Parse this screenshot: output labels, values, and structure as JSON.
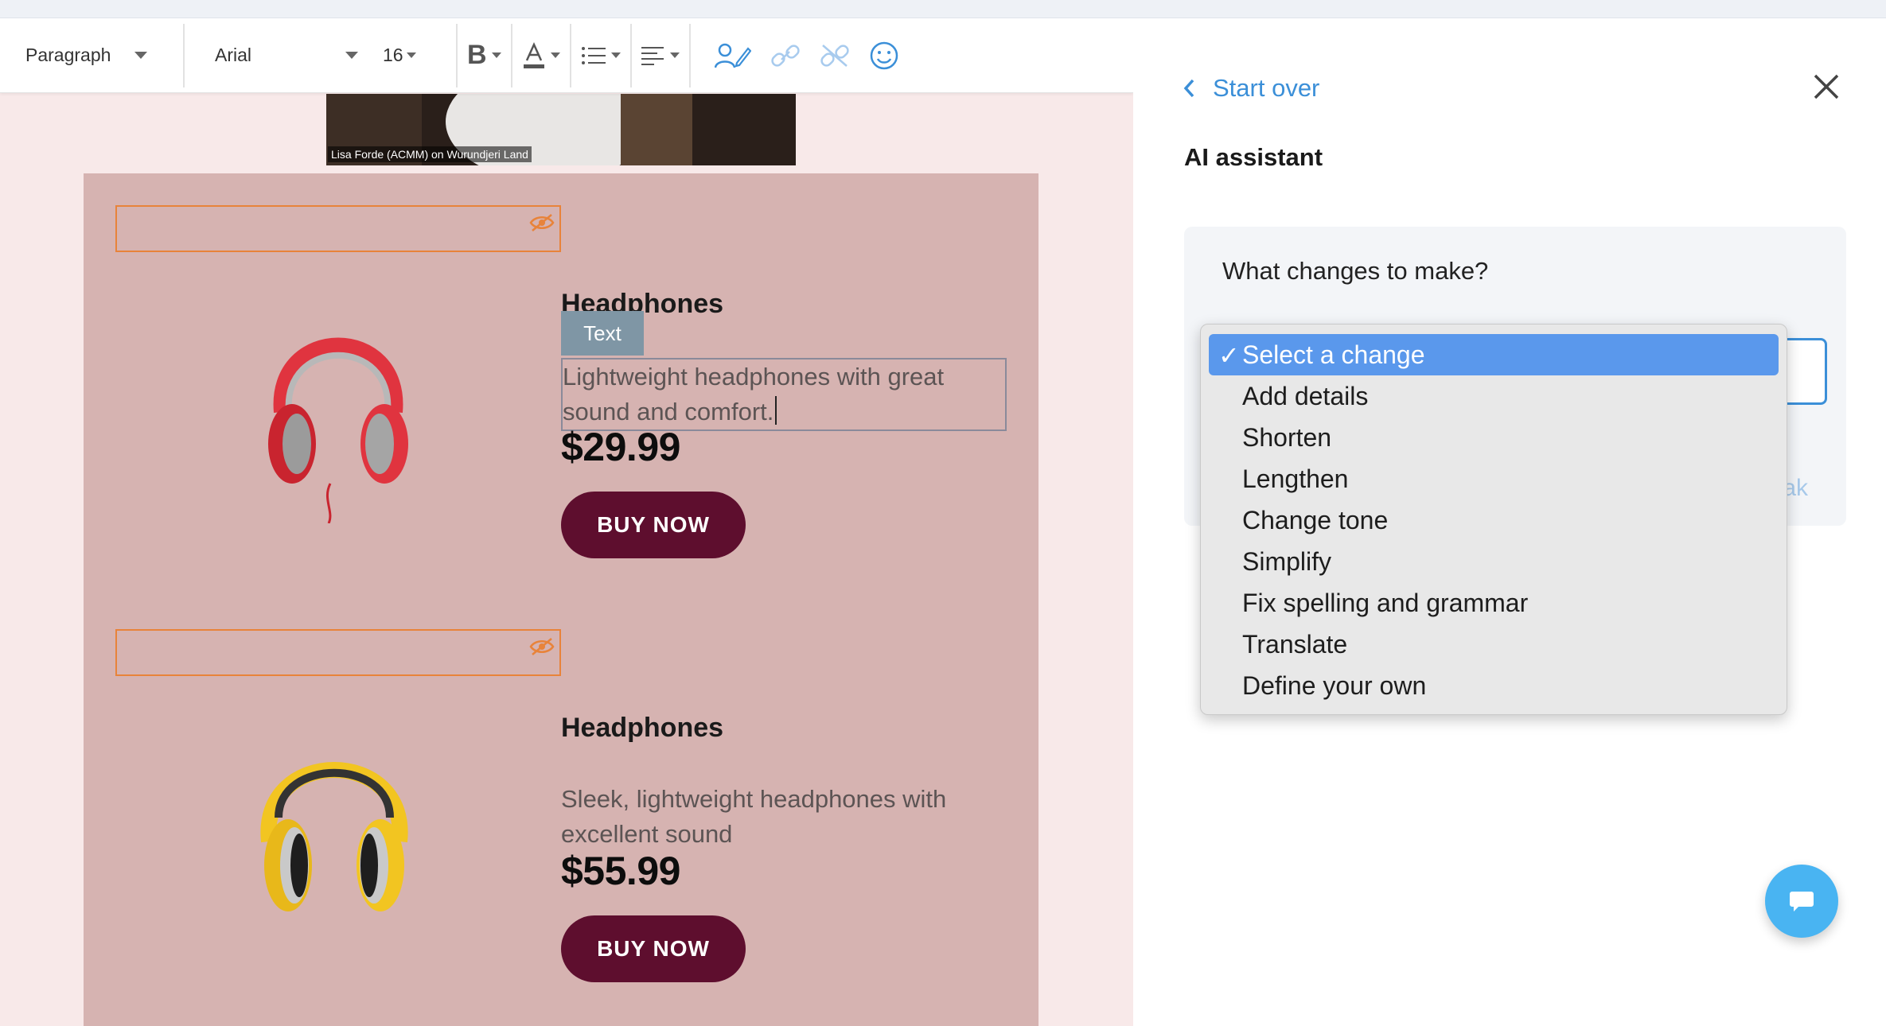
{
  "toolbar": {
    "paragraph_style": "Paragraph",
    "font_family": "Arial",
    "font_size": "16"
  },
  "video": {
    "caption": "Lisa Forde (ACMM) on Wurundjeri Land"
  },
  "products": [
    {
      "title": "Headphones",
      "description": "Lightweight headphones with great sound and comfort.",
      "price": "$29.99",
      "button": "BUY NOW",
      "color": "#e0343f"
    },
    {
      "title": "Headphones",
      "description": "Sleek, lightweight headphones with excellent sound",
      "price": "$55.99",
      "button": "BUY NOW",
      "color": "#f2c521"
    }
  ],
  "editor": {
    "text_tag": "Text"
  },
  "panel": {
    "back_label": "Start over",
    "title": "AI assistant",
    "question": "What changes to make?",
    "partial_link": "ak"
  },
  "dropdown": {
    "selected": "Select a change",
    "options": [
      "Select a change",
      "Add details",
      "Shorten",
      "Lengthen",
      "Change tone",
      "Simplify",
      "Fix spelling and grammar",
      "Translate",
      "Define your own"
    ]
  },
  "colors": {
    "accent": "#3b8fd8",
    "button": "#5e0e2e",
    "product_bg": "#d6b3b1",
    "editor_bg": "#f8e9e9",
    "hidden_outline": "#e8833a",
    "chat_fab": "#49b4f2"
  }
}
